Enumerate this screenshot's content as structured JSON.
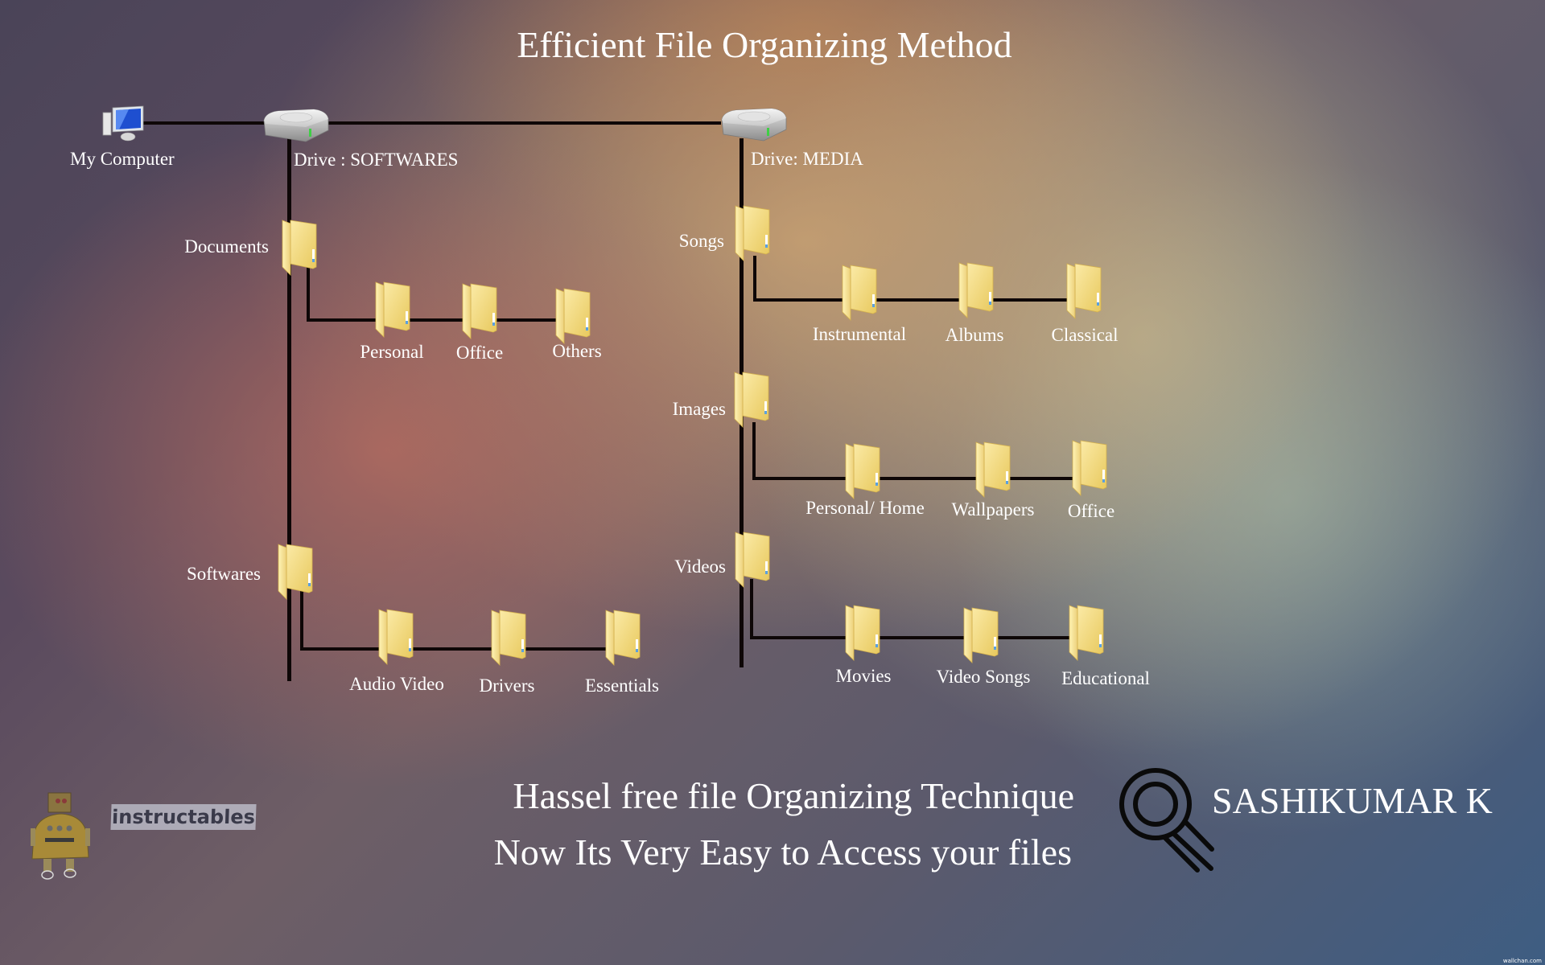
{
  "title": "Efficient File Organizing Method",
  "root": {
    "label": "My Computer",
    "icon": "computer-icon"
  },
  "drives": [
    {
      "label": "Drive : SOFTWARES",
      "icon": "hard-drive-icon",
      "folders": [
        {
          "label": "Documents",
          "children": [
            "Personal",
            "Office",
            "Others"
          ]
        },
        {
          "label": "Softwares",
          "children": [
            "Audio Video",
            "Drivers",
            "Essentials"
          ]
        }
      ]
    },
    {
      "label": "Drive: MEDIA",
      "icon": "hard-drive-icon",
      "folders": [
        {
          "label": "Songs",
          "children": [
            "Instrumental",
            "Albums",
            "Classical"
          ]
        },
        {
          "label": "Images",
          "children": [
            "Personal/ Home",
            "Wallpapers",
            "Office"
          ]
        },
        {
          "label": "Videos",
          "children": [
            "Movies",
            "Video Songs",
            "Educational"
          ]
        }
      ]
    }
  ],
  "tagline": {
    "line1": "Hassel free file Organizing Technique",
    "line2": "Now Its Very Easy to Access your files"
  },
  "author": "SASHIKUMAR K",
  "logo": {
    "text": "instructables",
    "icon": "robot-icon"
  },
  "watermark": "wallchan.com",
  "colors": {
    "connector": "#0e0707",
    "folder": "#f2d878",
    "text": "#ffffff"
  }
}
